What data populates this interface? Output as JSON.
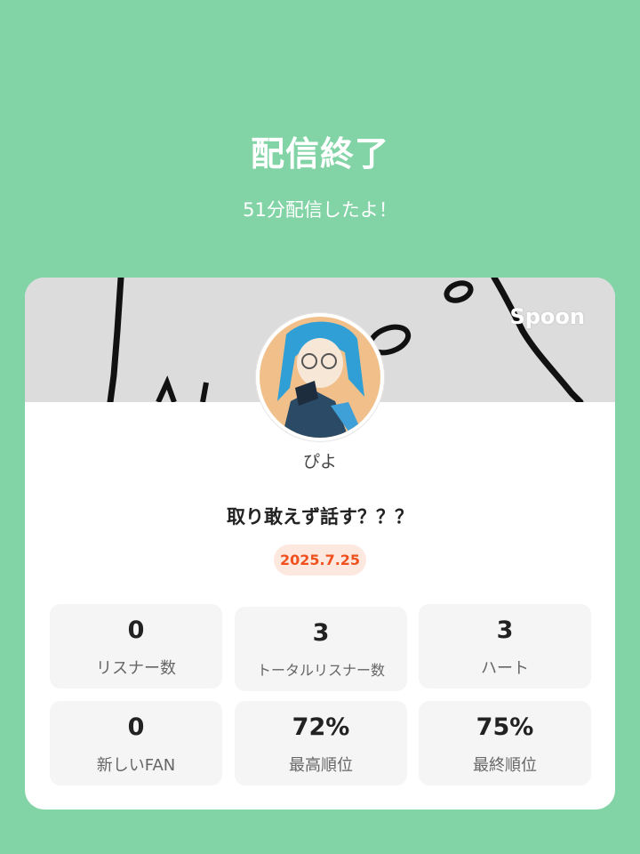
{
  "header": {
    "title": "配信終了",
    "subtitle": "51分配信したよ！"
  },
  "card": {
    "brand": "Spoon",
    "username": "ぴよ",
    "stream_title": "取り敢えず話す？？？",
    "date": "2025.7.25"
  },
  "stats": [
    {
      "value": "0",
      "label": "リスナー数"
    },
    {
      "value": "3",
      "label": "トータルリスナー数"
    },
    {
      "value": "3",
      "label": "ハート"
    },
    {
      "value": "0",
      "label": "新しいFAN"
    },
    {
      "value": "72%",
      "label": "最高順位"
    },
    {
      "value": "75%",
      "label": "最終順位"
    }
  ],
  "colors": {
    "background": "#82d4a6",
    "card": "#ffffff",
    "accent": "#f0511e",
    "badge_bg": "#fde8df",
    "stat_bg": "#f5f5f5"
  }
}
